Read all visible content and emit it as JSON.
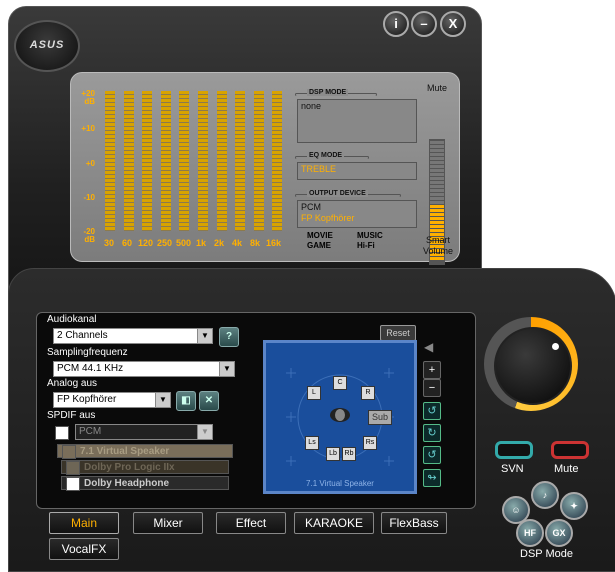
{
  "window": {
    "logo": "ASUS",
    "title_buttons": [
      {
        "name": "info",
        "glyph": "i"
      },
      {
        "name": "minimize",
        "glyph": "–"
      },
      {
        "name": "close",
        "glyph": "X"
      }
    ]
  },
  "eq": {
    "db_labels": [
      "+20\ndB",
      "+10",
      "+0",
      "-10",
      "-20\ndB"
    ],
    "frequencies": [
      "30",
      "60",
      "120",
      "250",
      "500",
      "1k",
      "2k",
      "4k",
      "8k",
      "16k"
    ],
    "dsp_mode": {
      "title": "DSP MODE",
      "value": "none"
    },
    "eq_mode": {
      "title": "EQ MODE",
      "value": "TREBLE"
    },
    "output_device": {
      "title": "OUTPUT DEVICE",
      "line1": "PCM",
      "line2": "FP Kopfhörer"
    },
    "modes": {
      "movie": "MOVIE",
      "game": "GAME",
      "music": "MUSIC",
      "hifi": "Hi-Fi"
    },
    "mute_label": "Mute",
    "smart_volume": "Smart\nVolume",
    "volume_fraction": 0.45
  },
  "controls": {
    "audiokanal_label": "Audiokanal",
    "audiokanal_value": "2 Channels",
    "help_glyph": "?",
    "sampling_label": "Samplingfrequenz",
    "sampling_value": "PCM 44.1 KHz",
    "analog_label": "Analog aus",
    "analog_value": "FP Kopfhörer",
    "spdif_label": "SPDIF aus",
    "spdif_value": "PCM",
    "virtual_speaker": "7.1 Virtual Speaker",
    "dolby_prologic": "Dolby Pro Logic IIx",
    "dolby_headphone": "Dolby Headphone",
    "reset": "Reset"
  },
  "speaker": {
    "channels": [
      "L",
      "C",
      "R",
      "Ls",
      "Rs",
      "Lb",
      "Rb",
      "Sub"
    ],
    "caption": "7.1 Virtual Speaker"
  },
  "tabs": [
    "Main",
    "Mixer",
    "Effect",
    "KARAOKE",
    "FlexBass",
    "VocalFX"
  ],
  "right": {
    "svn": "SVN",
    "mute": "Mute",
    "dsp_buttons": [
      "HF",
      "GX"
    ],
    "dsp_mode_label": "DSP Mode"
  },
  "colors": {
    "accent": "#ffb000",
    "eq_bg": "#8c8c8c",
    "speaker_bg": "#1a4e9c"
  }
}
